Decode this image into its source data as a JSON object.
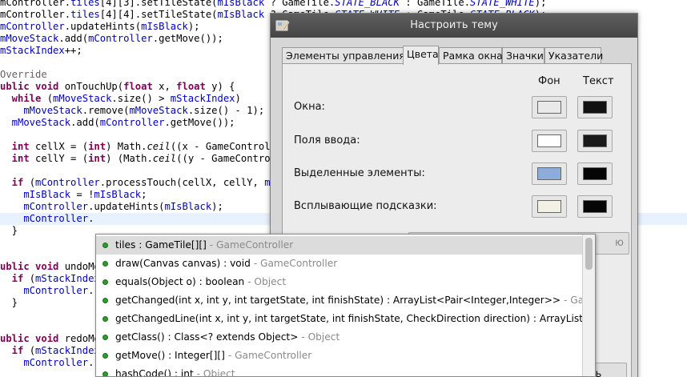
{
  "editor": {
    "lines": [
      {
        "segs": [
          [
            "mController.",
            "p"
          ],
          [
            "tiles",
            "fld"
          ],
          [
            "[4][3].setTileState(",
            "p"
          ],
          [
            "mIsBlack",
            "fld"
          ],
          [
            " ? GameTile.",
            "p"
          ],
          [
            "STATE_BLACK",
            "cst"
          ],
          [
            " : GameTile.",
            "p"
          ],
          [
            "STATE_WHITE",
            "cst"
          ],
          [
            ");",
            "p"
          ]
        ]
      },
      {
        "segs": [
          [
            "mController.",
            "p"
          ],
          [
            "tiles",
            "fld"
          ],
          [
            "[4][4].setTileState(",
            "p"
          ],
          [
            "mIsBlack",
            "fld"
          ],
          [
            " ? GameTile.",
            "p"
          ],
          [
            "STATE_WHITE",
            "cst"
          ],
          [
            " : GameTile.",
            "p"
          ],
          [
            "STATE_BLACK",
            "cst"
          ],
          [
            ");",
            "p"
          ]
        ]
      },
      {
        "segs": [
          [
            "mController",
            "fld"
          ],
          [
            ".updateHints(",
            "p"
          ],
          [
            "mIsBlack",
            "fld"
          ],
          [
            ");",
            "p"
          ]
        ]
      },
      {
        "segs": [
          [
            "mMoveStack",
            "fld"
          ],
          [
            ".add(",
            "p"
          ],
          [
            "mController",
            "fld"
          ],
          [
            ".getMove());",
            "p"
          ]
        ]
      },
      {
        "segs": [
          [
            "mStackIndex",
            "fld"
          ],
          [
            "++;",
            "p"
          ]
        ]
      },
      {
        "segs": []
      },
      {
        "segs": [
          [
            "Override",
            "ann"
          ]
        ]
      },
      {
        "segs": [
          [
            "ublic ",
            "kw"
          ],
          [
            "void ",
            "kw"
          ],
          [
            "onTouchUp(",
            "p"
          ],
          [
            "float ",
            "kw"
          ],
          [
            "x, ",
            "p"
          ],
          [
            "float ",
            "kw"
          ],
          [
            "y) {",
            "p"
          ]
        ]
      },
      {
        "segs": [
          [
            "  while ",
            "kw"
          ],
          [
            "(",
            "p"
          ],
          [
            "mMoveStack",
            "fld"
          ],
          [
            ".size() > ",
            "p"
          ],
          [
            "mStackIndex",
            "fld"
          ],
          [
            ")",
            "p"
          ]
        ]
      },
      {
        "segs": [
          [
            "    mMoveStack",
            "fld"
          ],
          [
            ".remove(",
            "p"
          ],
          [
            "mMoveStack",
            "fld"
          ],
          [
            ".size() - 1);",
            "p"
          ]
        ]
      },
      {
        "segs": [
          [
            "  mMoveStack",
            "fld"
          ],
          [
            ".add(",
            "p"
          ],
          [
            "mController",
            "fld"
          ],
          [
            ".getMove());",
            "p"
          ]
        ]
      },
      {
        "segs": []
      },
      {
        "segs": [
          [
            "  int ",
            "kw"
          ],
          [
            "cellX = (",
            "p"
          ],
          [
            "int",
            "kw"
          ],
          [
            ") Math.",
            "p"
          ],
          [
            "ceil",
            "itl"
          ],
          [
            "((x - GameControlle",
            "p"
          ]
        ]
      },
      {
        "segs": [
          [
            "  int ",
            "kw"
          ],
          [
            "cellY = (",
            "p"
          ],
          [
            "int",
            "kw"
          ],
          [
            ") (Math.",
            "p"
          ],
          [
            "ceil",
            "itl"
          ],
          [
            "((y - GameControll",
            "p"
          ]
        ]
      },
      {
        "segs": []
      },
      {
        "segs": [
          [
            "  if ",
            "kw"
          ],
          [
            "(",
            "p"
          ],
          [
            "mController",
            "fld"
          ],
          [
            ".processTouch(cellX, cellY, ",
            "p"
          ],
          [
            "mIs",
            "fld"
          ]
        ]
      },
      {
        "segs": [
          [
            "    mIsBlack",
            "fld"
          ],
          [
            " = !",
            "p"
          ],
          [
            "mIsBlack",
            "fld"
          ],
          [
            ";",
            "p"
          ]
        ]
      },
      {
        "segs": [
          [
            "    mController",
            "fld"
          ],
          [
            ".updateHints(",
            "p"
          ],
          [
            "mIsBlack",
            "fld"
          ],
          [
            ");",
            "p"
          ]
        ]
      },
      {
        "segs": [
          [
            "    mController",
            "fld"
          ],
          [
            ".",
            "p"
          ]
        ]
      },
      {
        "segs": [
          [
            "  }",
            "p"
          ]
        ]
      },
      {
        "segs": []
      },
      {
        "segs": []
      },
      {
        "segs": [
          [
            "ublic ",
            "kw"
          ],
          [
            "void ",
            "kw"
          ],
          [
            "undoMo",
            "p"
          ]
        ]
      },
      {
        "segs": [
          [
            "  if ",
            "kw"
          ],
          [
            "(",
            "p"
          ],
          [
            "mStackIndex",
            "fld"
          ]
        ]
      },
      {
        "segs": [
          [
            "    mController",
            "fld"
          ],
          [
            ".",
            "p"
          ]
        ]
      },
      {
        "segs": [
          [
            "  }",
            "p"
          ]
        ]
      },
      {
        "segs": []
      },
      {
        "segs": []
      },
      {
        "segs": [
          [
            "ublic ",
            "kw"
          ],
          [
            "void ",
            "kw"
          ],
          [
            "redoMo",
            "p"
          ]
        ]
      },
      {
        "segs": [
          [
            "  if ",
            "kw"
          ],
          [
            "(",
            "p"
          ],
          [
            "mStackIndex",
            "fld"
          ]
        ]
      },
      {
        "segs": [
          [
            "    mController",
            "fld"
          ],
          [
            ".",
            "p"
          ]
        ]
      }
    ],
    "highlighted_line": 18
  },
  "dialog": {
    "title": "Настроить тему",
    "tabs": [
      {
        "label": "Элементы управления",
        "active": false
      },
      {
        "label": "Цвета",
        "active": true
      },
      {
        "label": "Рамка окна",
        "active": false
      },
      {
        "label": "Значки",
        "active": false
      },
      {
        "label": "Указатели",
        "active": false
      }
    ],
    "col_background": "Фон",
    "col_text": "Текст",
    "rows": [
      {
        "label": "Окна:",
        "bg": "#e9e9e9",
        "fg": "#111111"
      },
      {
        "label": "Поля ввода:",
        "bg": "#ffffff",
        "fg": "#1a1a1a"
      },
      {
        "label": "Выделенные элементы:",
        "bg": "#8cacdc",
        "fg": "#050505"
      },
      {
        "label": "Всплывающие подсказки:",
        "bg": "#f3f1e4",
        "fg": "#050505"
      }
    ],
    "hidden_button_fragment": "ю",
    "close_button_fragment": "ть"
  },
  "assist": {
    "items": [
      {
        "name": "tiles : GameTile[][]",
        "owner": " - GameController",
        "selected": true
      },
      {
        "name": "draw(Canvas canvas) : void",
        "owner": " - GameController",
        "selected": false
      },
      {
        "name": "equals(Object o) : boolean",
        "owner": " - Object",
        "selected": false
      },
      {
        "name": "getChanged(int x, int y, int targetState, int finishState) : ArrayList<Pair<Integer,Integer>>",
        "owner": " - GameCon",
        "selected": false
      },
      {
        "name": "getChangedLine(int x, int y, int targetState, int finishState, CheckDirection direction) : ArrayList<Pair<",
        "owner": "",
        "selected": false
      },
      {
        "name": "getClass() : Class<? extends Object>",
        "owner": " - Object",
        "selected": false
      },
      {
        "name": "getMove() : Integer[][]",
        "owner": " - GameController",
        "selected": false
      },
      {
        "name": "hashCode() : int",
        "owner": " - Object",
        "selected": false
      }
    ],
    "dot_color": "#2f9a2f"
  }
}
